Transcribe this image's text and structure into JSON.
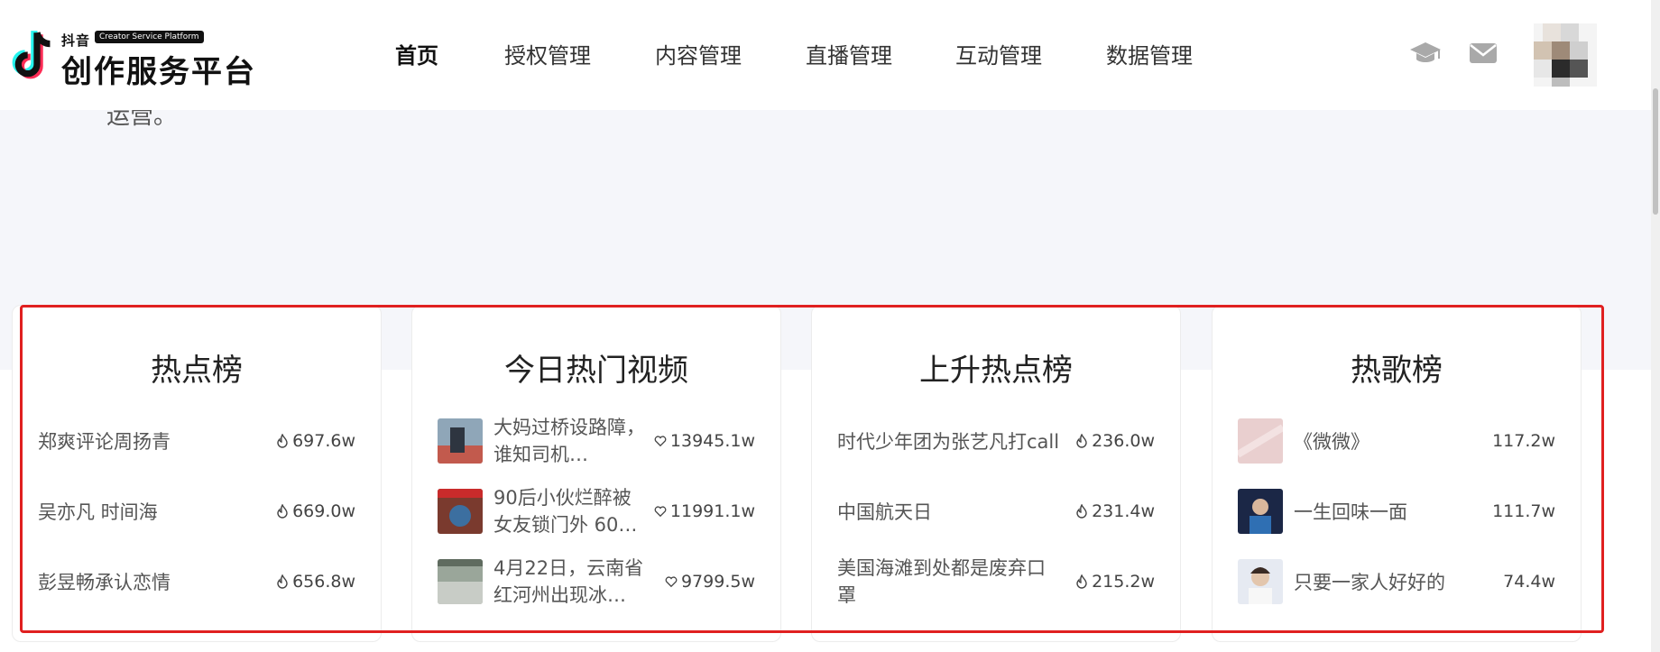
{
  "header": {
    "logo_small": "抖音",
    "logo_tag": "Creator Service Platform",
    "logo_big": "创作服务平台",
    "nav": [
      {
        "label": "首页",
        "active": true
      },
      {
        "label": "授权管理",
        "active": false
      },
      {
        "label": "内容管理",
        "active": false
      },
      {
        "label": "直播管理",
        "active": false
      },
      {
        "label": "互动管理",
        "active": false
      },
      {
        "label": "数据管理",
        "active": false
      }
    ],
    "icons": [
      "graduation-cap-icon",
      "mail-icon"
    ]
  },
  "intro_text": "运营。",
  "colors": {
    "highlight_border": "#e02020",
    "page_bg": "#f5f6fa"
  },
  "cards": [
    {
      "title": "热点榜",
      "rows": [
        {
          "text": "郑爽评论周扬青",
          "metric": "697.6w",
          "icon": "fire-icon"
        },
        {
          "text": "吴亦凡 时间海",
          "metric": "669.0w",
          "icon": "fire-icon"
        },
        {
          "text": "彭昱畅承认恋情",
          "metric": "656.8w",
          "icon": "fire-icon"
        }
      ]
    },
    {
      "title": "今日热门视频",
      "rows": [
        {
          "text": "大妈过桥设路障，谁知司机…",
          "metric": "13945.1w",
          "icon": "heart-icon"
        },
        {
          "text": "90后小伙烂醉被女友锁门外 60…",
          "metric": "11991.1w",
          "icon": "heart-icon"
        },
        {
          "text": "4月22日，云南省红河州出现冰…",
          "metric": "9799.5w",
          "icon": "heart-icon"
        }
      ]
    },
    {
      "title": "上升热点榜",
      "rows": [
        {
          "text": "时代少年团为张艺凡打call",
          "metric": "236.0w",
          "icon": "fire-icon"
        },
        {
          "text": "中国航天日",
          "metric": "231.4w",
          "icon": "fire-icon"
        },
        {
          "text": "美国海滩到处都是废弃口罩",
          "metric": "215.2w",
          "icon": "fire-icon"
        }
      ]
    },
    {
      "title": "热歌榜",
      "rows": [
        {
          "text": "《微微》",
          "metric": "117.2w"
        },
        {
          "text": "一生回味一面",
          "metric": "111.7w"
        },
        {
          "text": "只要一家人好好的",
          "metric": "74.4w"
        }
      ]
    }
  ]
}
